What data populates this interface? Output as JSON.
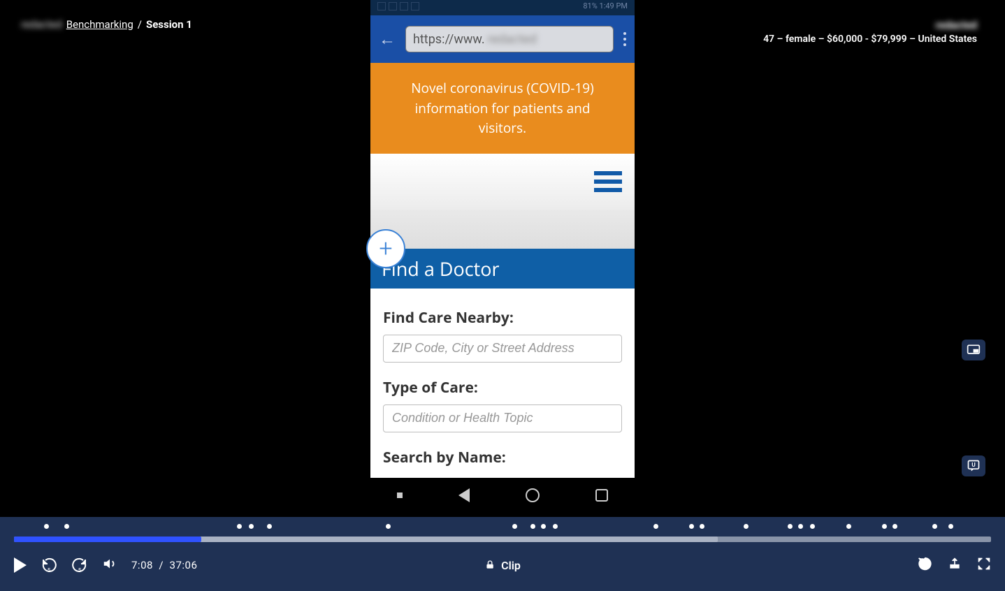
{
  "breadcrumb": {
    "blurred_prefix": "redacted",
    "link": "Benchmarking",
    "separator": "/",
    "current": "Session 1"
  },
  "participant": {
    "name_blurred": "redacted",
    "age": "47",
    "gender": "female",
    "income": "$60,000 - $79,999",
    "country": "United States"
  },
  "phone": {
    "status_time": "1:49 PM",
    "status_battery": "81%",
    "url_prefix": "https://www.",
    "url_rest_blurred": "redacted",
    "banner_line": "Novel coronavirus (COVID-19) information for patients and visitors.",
    "section_heading": "Find a Doctor",
    "form": {
      "label_location": "Find Care Nearby:",
      "placeholder_location": "ZIP Code, City or Street Address",
      "label_type": "Type of Care:",
      "placeholder_type": "Condition or Health Topic",
      "label_name": "Search by Name:"
    }
  },
  "player": {
    "current_time": "7:08",
    "duration": "37:06",
    "progress_pct": 19.2,
    "buffer_pct": 72,
    "clip_label": "Clip",
    "markers_pct": [
      3.0,
      5.0,
      22.2,
      23.4,
      25.2,
      37.0,
      49.6,
      51.4,
      52.4,
      53.6,
      63.6,
      67.2,
      68.2,
      72.6,
      77.0,
      78.0,
      79.2,
      82.8,
      86.4,
      87.4,
      91.4,
      93.0
    ]
  }
}
